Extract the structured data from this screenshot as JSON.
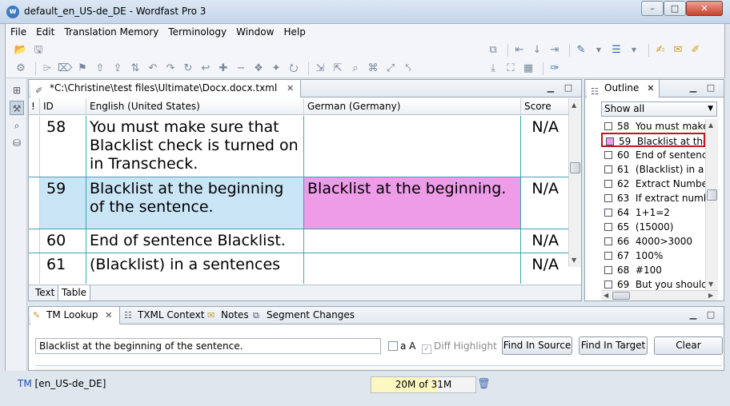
{
  "window": {
    "title": "default_en_US-de_DE - Wordfast Pro 3",
    "controls": {
      "minimize": "–",
      "maximize": "□",
      "close": "✕"
    }
  },
  "menu": [
    "File",
    "Edit",
    "Translation Memory",
    "Terminology",
    "Window",
    "Help"
  ],
  "editor": {
    "tab_title": "*C:\\Christine\\test files\\Ultimate\\Docx.docx.txml",
    "tab_close": "✕",
    "columns": {
      "mark": "!",
      "id": "ID",
      "source": "English (United States)",
      "target": "German (Germany)",
      "score": "Score"
    },
    "rows": [
      {
        "id": "58",
        "source": "You must make sure that Blacklist check is turned on in Transcheck.",
        "target": "",
        "score": "N/A"
      },
      {
        "id": "59",
        "source": "Blacklist at the beginning of the sentence.",
        "target": "Blacklist at the beginning.",
        "score": "N/A"
      },
      {
        "id": "60",
        "source": "End of sentence Blacklist.",
        "target": "",
        "score": "N/A"
      },
      {
        "id": "61",
        "source": "(Blacklist) in a sentences",
        "target": "",
        "score": "N/A"
      }
    ],
    "bottom_tabs": {
      "text": "Text",
      "table": "Table"
    }
  },
  "outline": {
    "title": "Outline",
    "filter": "Show all",
    "items": [
      {
        "id": "58",
        "text": "You must make sure"
      },
      {
        "id": "59",
        "text": "Blacklist at the beginning"
      },
      {
        "id": "60",
        "text": "End of sentence Blacklist."
      },
      {
        "id": "61",
        "text": "(Blacklist) in a sentences"
      },
      {
        "id": "62",
        "text": "Extract Numbers"
      },
      {
        "id": "63",
        "text": "If extract numbers"
      },
      {
        "id": "64",
        "text": "1+1=2"
      },
      {
        "id": "65",
        "text": "(15000)"
      },
      {
        "id": "66",
        "text": "4000>3000"
      },
      {
        "id": "67",
        "text": "100%"
      },
      {
        "id": "68",
        "text": "#100"
      },
      {
        "id": "69",
        "text": "But you should"
      }
    ]
  },
  "bottom_panel": {
    "tabs": {
      "tm_lookup": "TM Lookup",
      "txml_context": "TXML Context",
      "notes": "Notes",
      "segment_changes": "Segment Changes"
    },
    "lookup_text": "Blacklist at the beginning of the sentence.",
    "checkbox_aa": "a A",
    "checkbox_diff": "Diff Highlight",
    "btn_find_source": "Find In Source",
    "btn_find_target": "Find In Target",
    "btn_clear": "Clear"
  },
  "status": {
    "tm_label": "TM",
    "tm_pair": "[en_US-de_DE]",
    "memory": "20M of 31M"
  },
  "colors": {
    "active_source": "#c9e5f6",
    "active_target": "#ee9be8",
    "row_border": "#36a9b3",
    "outline_highlight": "#c0161c"
  }
}
